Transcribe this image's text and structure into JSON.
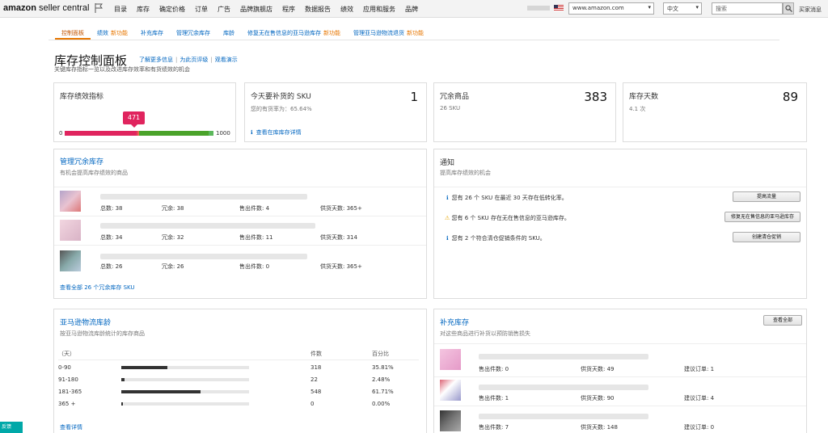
{
  "header": {
    "logo_a": "amazon",
    "logo_b": "seller central",
    "nav": [
      "目录",
      "库存",
      "确定价格",
      "订单",
      "广告",
      "品牌旗舰店",
      "程序",
      "数据报告",
      "绩效",
      "应用和服务",
      "品牌"
    ],
    "marketplace": "www.amazon.com",
    "language": "中文",
    "search_placeholder": "搜索",
    "right_link": "买家消息"
  },
  "tabs": [
    {
      "label": "控制面板",
      "new": ""
    },
    {
      "label": "绩效",
      "new": "新功能"
    },
    {
      "label": "补充库存",
      "new": ""
    },
    {
      "label": "管理冗余库存",
      "new": ""
    },
    {
      "label": "库龄",
      "new": ""
    },
    {
      "label": "修复无在售信息的亚马逊库存",
      "new": "新功能"
    },
    {
      "label": "管理亚马逊物流退货",
      "new": "新功能"
    }
  ],
  "page": {
    "title": "库存控制面板",
    "links": [
      "了解更多信息",
      "为此页评级",
      "观看演示"
    ],
    "subtitle": "关键库存指标一览以及改进库存效率和有货绩效的机会"
  },
  "ipi": {
    "title": "库存绩效指标",
    "score": 471,
    "score_fraction": 0.471,
    "min": "0",
    "max": "1000"
  },
  "restock_today": {
    "title": "今天要补货的 SKU",
    "count": "1",
    "sub": "您的有货率为：65.64%",
    "link": "查看在库库存详情"
  },
  "excess": {
    "title": "冗余商品",
    "count": "383",
    "sub": "26 SKU"
  },
  "days_supply": {
    "title": "库存天数",
    "count": "89",
    "sub": "4.1 次"
  },
  "manage_excess": {
    "title": "管理冗余库存",
    "sub": "有机会提高库存绩效的商品",
    "rows": [
      {
        "total": "总数: 38",
        "excess": "冗余: 38",
        "sold": "售出件数: 4",
        "supply": "供货天数: 365+"
      },
      {
        "total": "总数: 34",
        "excess": "冗余: 32",
        "sold": "售出件数: 11",
        "supply": "供货天数: 314"
      },
      {
        "total": "总数: 26",
        "excess": "冗余: 26",
        "sold": "售出件数: 0",
        "supply": "供货天数: 365+"
      }
    ],
    "footer_link": "查看全部 26 个冗余库存 SKU"
  },
  "notices": {
    "title": "通知",
    "sub": "提高库存绩效的机会",
    "items": [
      {
        "text": "您有 26 个 SKU 在最近 30 天存在低转化率。",
        "button": "提高流量",
        "type": "info"
      },
      {
        "text": "您有 6 个 SKU 存在无在售信息的亚马逊库存。",
        "button": "修复无在售信息的亚马逊库存",
        "type": "warning"
      },
      {
        "text": "您有 2 个符合清仓促销条件的 SKU。",
        "button": "创建清仓促销",
        "type": "info"
      }
    ]
  },
  "fba_age": {
    "title": "亚马逊物流库龄",
    "sub": "按亚马逊物流库龄统计的库存商品",
    "col_days": "（天）",
    "col_units": "件数",
    "col_pct": "百分比",
    "rows": [
      {
        "range": "0-90",
        "units": "318",
        "pct": "35.81%",
        "fraction": 0.3581
      },
      {
        "range": "91-180",
        "units": "22",
        "pct": "2.48%",
        "fraction": 0.0248
      },
      {
        "range": "181-365",
        "units": "548",
        "pct": "61.71%",
        "fraction": 0.6171
      },
      {
        "range": "365 +",
        "units": "0",
        "pct": "0.00%",
        "fraction": 0.0
      }
    ],
    "footer_link": "查看详情"
  },
  "replenish": {
    "title": "补充库存",
    "sub": "对这些商品进行补货以预防销售损失",
    "button": "查看全部",
    "rows": [
      {
        "sold": "售出件数: 0",
        "supply": "供货天数: 49",
        "suggest": "建议订单: 1"
      },
      {
        "sold": "售出件数: 1",
        "supply": "供货天数: 90",
        "suggest": "建议订单: 4"
      },
      {
        "sold": "售出件数: 7",
        "supply": "供货天数: 148",
        "suggest": "建议订单: 0"
      }
    ]
  },
  "feedback_label": "反馈",
  "colors": {
    "link": "#0066c0",
    "accent": "#e77600",
    "ipi_badge": "#e0245e",
    "ipi_good": "#4aa32a"
  }
}
